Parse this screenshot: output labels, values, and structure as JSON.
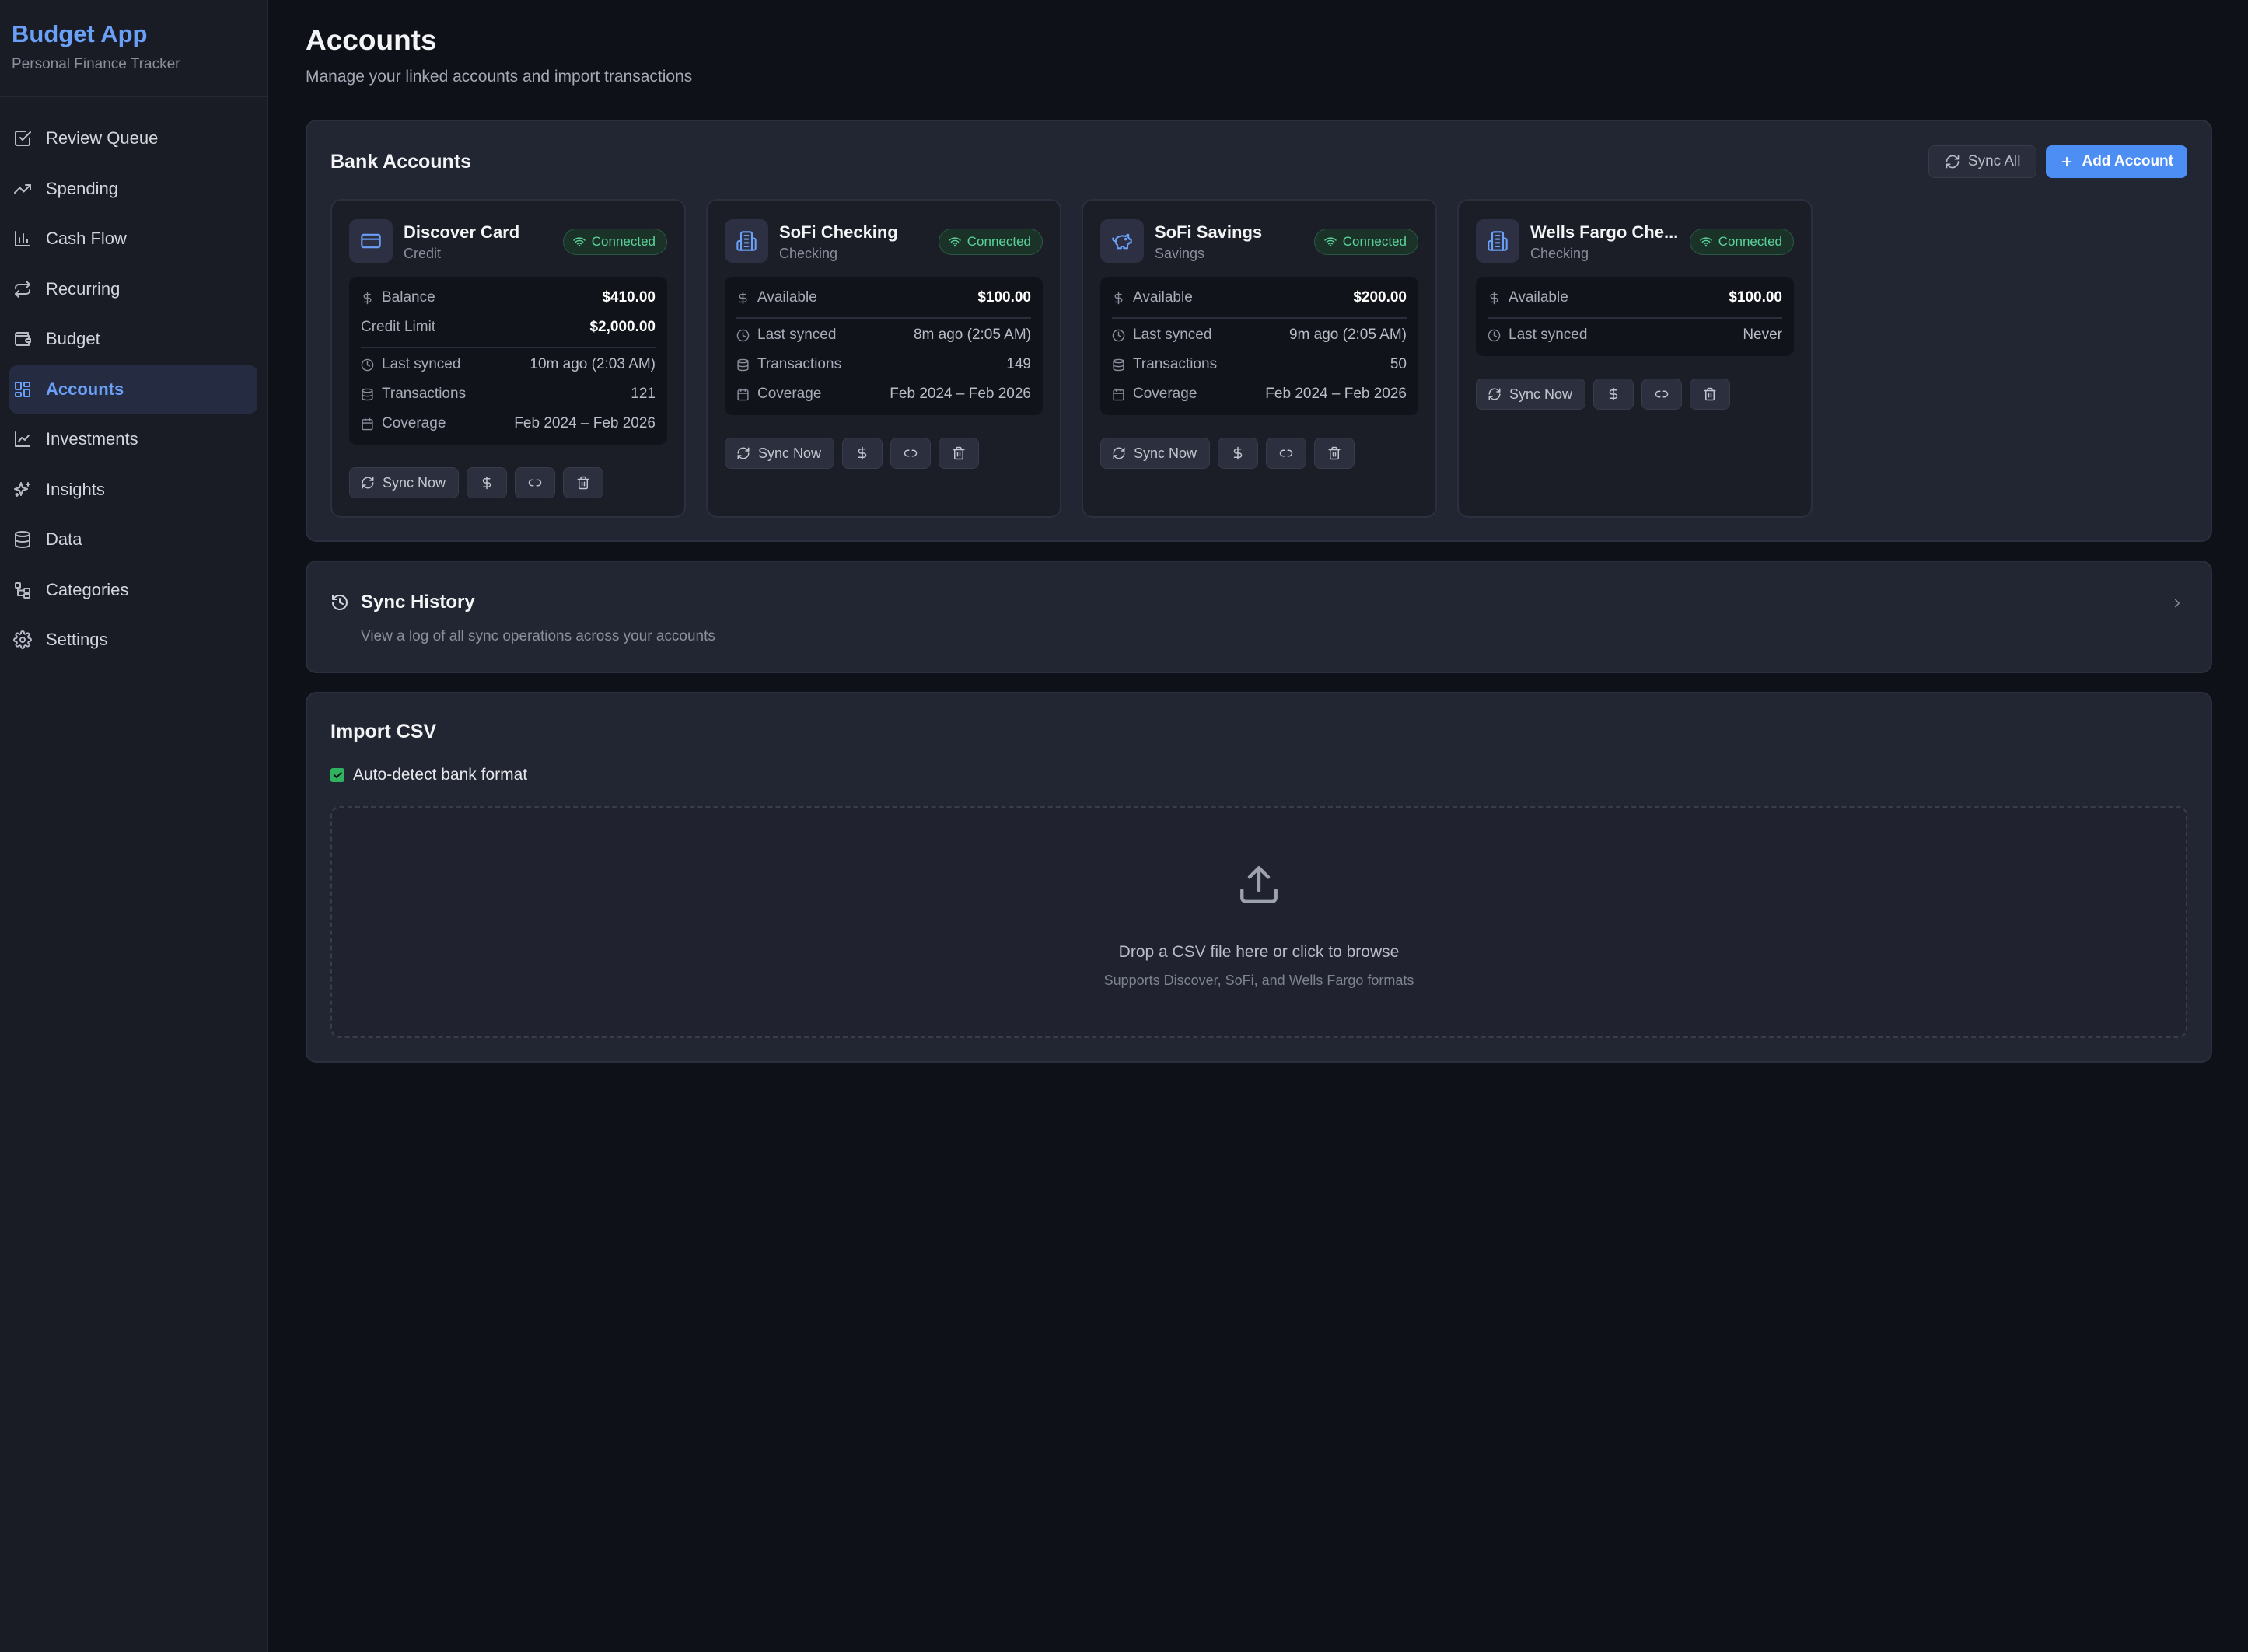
{
  "brand": {
    "title": "Budget App",
    "subtitle": "Personal Finance Tracker"
  },
  "nav": {
    "items": [
      {
        "label": "Review Queue",
        "icon": "checkbox-icon"
      },
      {
        "label": "Spending",
        "icon": "trend-icon"
      },
      {
        "label": "Cash Flow",
        "icon": "bar-chart-icon"
      },
      {
        "label": "Recurring",
        "icon": "repeat-icon"
      },
      {
        "label": "Budget",
        "icon": "wallet-icon"
      },
      {
        "label": "Accounts",
        "icon": "grid-icon",
        "active": true
      },
      {
        "label": "Investments",
        "icon": "line-chart-icon"
      },
      {
        "label": "Insights",
        "icon": "sparkles-icon"
      },
      {
        "label": "Data",
        "icon": "database-icon"
      },
      {
        "label": "Categories",
        "icon": "tree-icon"
      },
      {
        "label": "Settings",
        "icon": "gear-icon"
      }
    ]
  },
  "header": {
    "title": "Accounts",
    "subtitle": "Manage your linked accounts and import transactions"
  },
  "bank": {
    "title": "Bank Accounts",
    "sync_all": "Sync All",
    "add_account": "Add Account",
    "accounts": [
      {
        "name": "Discover Card",
        "type": "Credit",
        "status": "Connected",
        "icon": "credit-card-icon",
        "primary_label": "Balance",
        "primary_value": "$410.00",
        "credit_limit_label": "Credit Limit",
        "credit_limit_value": "$2,000.00",
        "last_synced_label": "Last synced",
        "last_synced": "10m ago (2:03 AM)",
        "transactions_label": "Transactions",
        "transactions": "121",
        "coverage_label": "Coverage",
        "coverage": "Feb 2024 – Feb 2026",
        "sync_now": "Sync Now"
      },
      {
        "name": "SoFi Checking",
        "type": "Checking",
        "status": "Connected",
        "icon": "building-icon",
        "primary_label": "Available",
        "primary_value": "$100.00",
        "last_synced_label": "Last synced",
        "last_synced": "8m ago (2:05 AM)",
        "transactions_label": "Transactions",
        "transactions": "149",
        "coverage_label": "Coverage",
        "coverage": "Feb 2024 – Feb 2026",
        "sync_now": "Sync Now"
      },
      {
        "name": "SoFi Savings",
        "type": "Savings",
        "status": "Connected",
        "icon": "piggy-bank-icon",
        "primary_label": "Available",
        "primary_value": "$200.00",
        "last_synced_label": "Last synced",
        "last_synced": "9m ago (2:05 AM)",
        "transactions_label": "Transactions",
        "transactions": "50",
        "coverage_label": "Coverage",
        "coverage": "Feb 2024 – Feb 2026",
        "sync_now": "Sync Now"
      },
      {
        "name": "Wells Fargo Che...",
        "type": "Checking",
        "status": "Connected",
        "icon": "building-icon",
        "primary_label": "Available",
        "primary_value": "$100.00",
        "last_synced_label": "Last synced",
        "last_synced": "Never",
        "sync_now": "Sync Now"
      }
    ]
  },
  "history": {
    "title": "Sync History",
    "subtitle": "View a log of all sync operations across your accounts"
  },
  "import": {
    "title": "Import CSV",
    "auto_detect_label": "Auto-detect bank format",
    "auto_detect_checked": true,
    "drop_text": "Drop a CSV file here or click to browse",
    "drop_hint": "Supports Discover, SoFi, and Wells Fargo formats"
  },
  "colors": {
    "accent": "#4d8ef5",
    "accent_text": "#6aa0f7",
    "connected": "#5ad39a",
    "background": "#0f1118",
    "panel": "#222532"
  }
}
